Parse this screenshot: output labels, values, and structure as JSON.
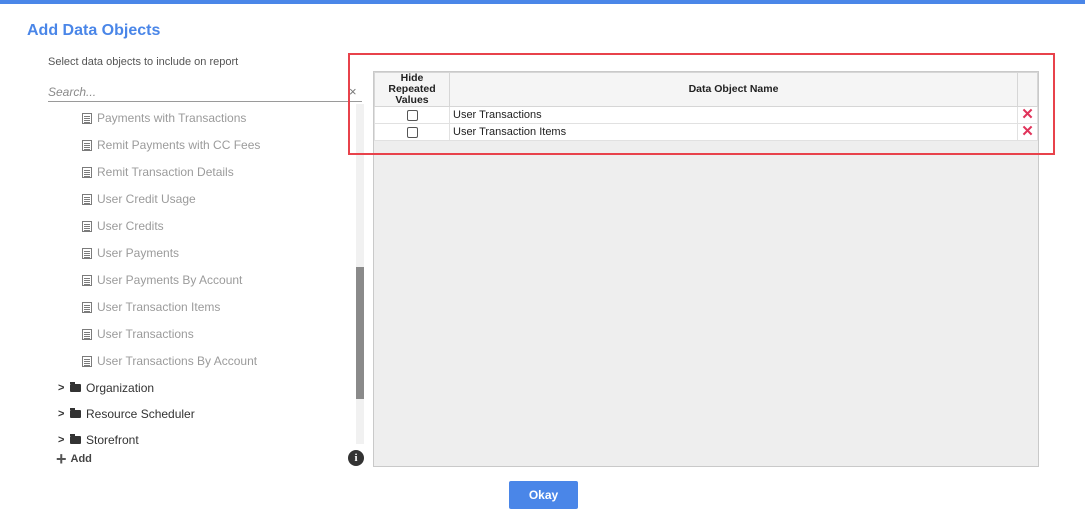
{
  "dialog": {
    "title": "Add Data Objects",
    "subtitle": "Select data objects to include on report",
    "accent_color": "#4a86e8"
  },
  "search": {
    "value": "",
    "placeholder": "Search...",
    "clear_label": "×"
  },
  "tree": {
    "items": [
      {
        "label": "Payments with Transactions",
        "icon": "document-icon"
      },
      {
        "label": "Remit Payments with CC Fees",
        "icon": "document-icon"
      },
      {
        "label": "Remit Transaction Details",
        "icon": "document-icon"
      },
      {
        "label": "User Credit Usage",
        "icon": "document-icon"
      },
      {
        "label": "User Credits",
        "icon": "document-icon"
      },
      {
        "label": "User Payments",
        "icon": "document-icon"
      },
      {
        "label": "User Payments By Account",
        "icon": "document-icon"
      },
      {
        "label": "User Transaction Items",
        "icon": "document-icon"
      },
      {
        "label": "User Transactions",
        "icon": "document-icon"
      },
      {
        "label": "User Transactions By Account",
        "icon": "document-icon"
      }
    ],
    "folders": [
      {
        "label": "Organization",
        "icon": "folder-icon"
      },
      {
        "label": "Resource Scheduler",
        "icon": "folder-icon"
      },
      {
        "label": "Storefront",
        "icon": "folder-icon"
      }
    ],
    "chevron": ">"
  },
  "actions": {
    "add_label": "Add",
    "add_icon": "+",
    "info_icon": "i",
    "okay_label": "Okay"
  },
  "grid": {
    "headers": {
      "hide_repeated_line1": "Hide Repeated",
      "hide_repeated_line2": "Values",
      "name": "Data Object Name"
    },
    "rows": [
      {
        "name": "User Transactions",
        "hide_repeated": false
      },
      {
        "name": "User Transaction Items",
        "hide_repeated": false
      }
    ],
    "remove_icon": "✕",
    "remove_color": "#e0335a"
  },
  "highlight_color": "#e8424b"
}
